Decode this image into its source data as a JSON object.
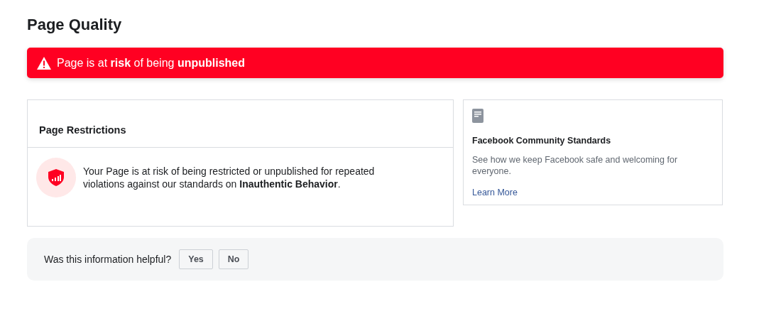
{
  "title": "Page Quality",
  "alert": {
    "text": "Page is at **risk** of being **unpublished**"
  },
  "restrictions": {
    "title": "Page Restrictions",
    "message": "Your Page is at risk of being restricted or unpublished for repeated violations against our standards on **Inauthentic Behavior**."
  },
  "standards": {
    "title": "Facebook Community Standards",
    "description": "See how we keep Facebook safe and welcoming for everyone.",
    "link": "Learn More"
  },
  "feedback": {
    "question": "Was this information helpful?",
    "buttons": [
      "Yes",
      "No"
    ]
  }
}
